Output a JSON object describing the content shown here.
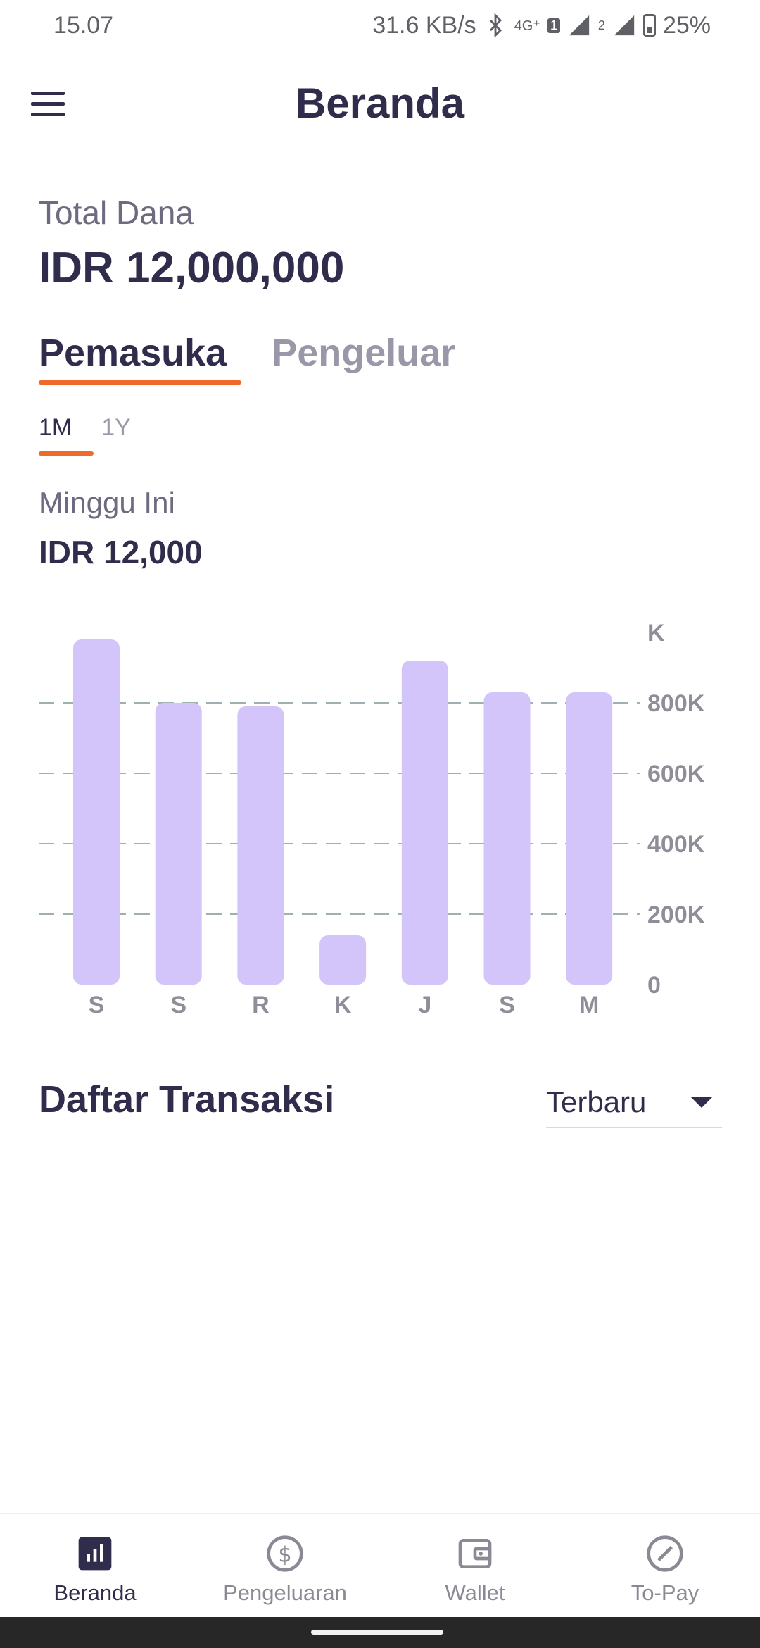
{
  "status_bar": {
    "time": "15.07",
    "network_speed": "31.6 KB/s",
    "network_type": "4G⁺",
    "sim1_badge": "1",
    "sim2_badge": "2",
    "battery": "25%"
  },
  "header": {
    "title": "Beranda"
  },
  "summary": {
    "total_label": "Total Dana",
    "total_value": "IDR 12,000,000"
  },
  "type_tabs": [
    {
      "label": "Pemasuka",
      "active": true
    },
    {
      "label": "Pengeluar",
      "active": false
    }
  ],
  "range_tabs": [
    {
      "label": "1M",
      "active": true
    },
    {
      "label": "1Y",
      "active": false
    }
  ],
  "period": {
    "label": "Minggu Ini",
    "value": "IDR 12,000"
  },
  "chart_data": {
    "type": "bar",
    "categories": [
      "S",
      "S",
      "R",
      "K",
      "J",
      "S",
      "M"
    ],
    "values": [
      980,
      800,
      790,
      140,
      920,
      830,
      830
    ],
    "y_ticks": [
      "0",
      "200K",
      "400K",
      "600K",
      "800K",
      "K"
    ],
    "ylim": [
      0,
      1000
    ],
    "grid": true,
    "bar_color": "#d3c5f9"
  },
  "transactions": {
    "title": "Daftar Transaksi",
    "sort_selected": "Terbaru"
  },
  "bottom_nav": [
    {
      "label": "Beranda",
      "icon": "bar-chart-icon",
      "active": true
    },
    {
      "label": "Pengeluaran",
      "icon": "dollar-circle-icon",
      "active": false
    },
    {
      "label": "Wallet",
      "icon": "wallet-icon",
      "active": false
    },
    {
      "label": "To-Pay",
      "icon": "compass-pen-icon",
      "active": false
    }
  ],
  "colors": {
    "accent": "#ef6a2a",
    "text_primary": "#302d4c",
    "bar": "#d3c5f9"
  }
}
